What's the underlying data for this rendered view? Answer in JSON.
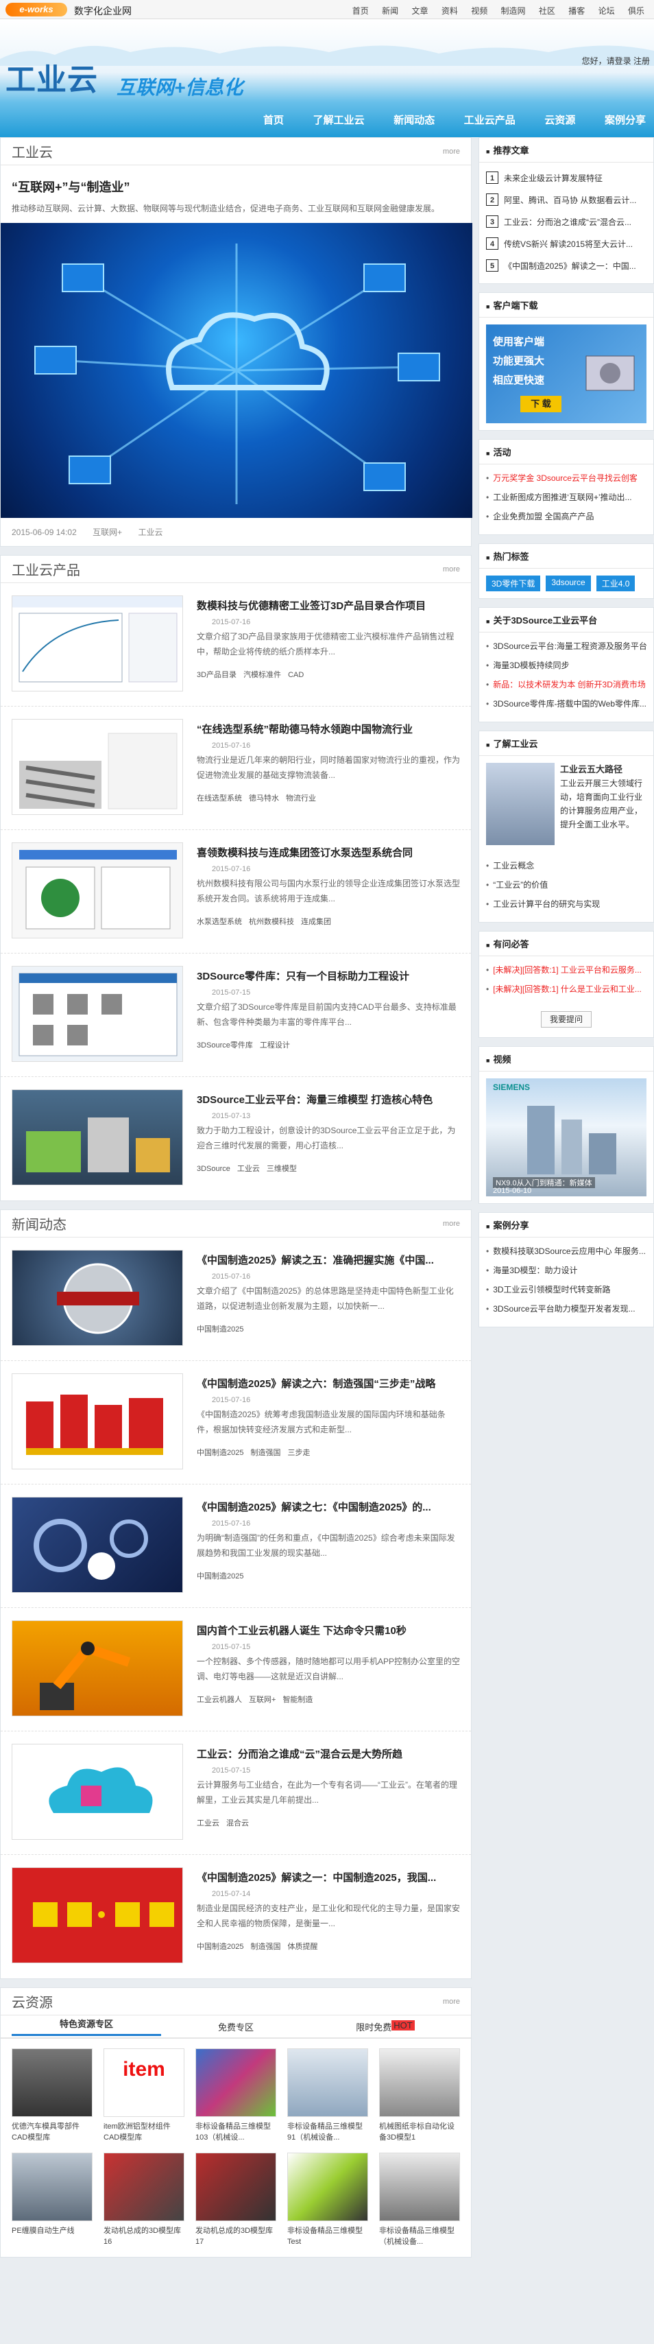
{
  "top": {
    "logo": "e-works",
    "site": "数字化企业网",
    "nav": [
      "首页",
      "新闻",
      "文章",
      "资料",
      "视频",
      "制造网",
      "社区",
      "播客",
      "论坛",
      "俱乐"
    ]
  },
  "banner": {
    "title": "工业云",
    "subtitle": "互联网+信息化",
    "login": "您好，请登录  注册",
    "menu": [
      "首页",
      "了解工业云",
      "新闻动态",
      "工业云产品",
      "云资源",
      "案例分享"
    ]
  },
  "cloud": {
    "header": "工业云",
    "more": "more",
    "title": "“互联网+”与“制造业”",
    "desc": "推动移动互联网、云计算、大数据、物联网等与现代制造业结合，促进电子商务、工业互联网和互联网金融健康发展。",
    "date": "2015-06-09 14:02",
    "tags": [
      "互联网+",
      "工业云"
    ]
  },
  "products": {
    "header": "工业云产品",
    "more": "more",
    "items": [
      {
        "title": "数模科技与优德精密工业签订3D产品目录合作项目",
        "date": "2015-07-16",
        "desc": "文章介绍了3D产品目录家族用于优德精密工业汽模标准件产品销售过程中，帮助企业将传统的纸介质样本升...",
        "tags": [
          "3D产品目录",
          "汽模标准件",
          "CAD"
        ]
      },
      {
        "title": "“在线选型系统”帮助德马特水领跑中国物流行业",
        "date": "2015-07-16",
        "desc": "物流行业是近几年来的朝阳行业，同时随着国家对物流行业的重视，作为促进物流业发展的基础支撑物流装备...",
        "tags": [
          "在线选型系统",
          "德马特水",
          "物流行业"
        ]
      },
      {
        "title": "喜领数模科技与连成集团签订水泵选型系统合同",
        "date": "2015-07-16",
        "desc": "杭州数模科技有限公司与国内水泵行业的领导企业连成集团签订水泵选型系统开发合同。该系统将用于连成集...",
        "tags": [
          "水泵选型系统",
          "杭州数模科技",
          "连成集团"
        ]
      },
      {
        "title": "3DSource零件库：只有一个目标助力工程设计",
        "date": "2015-07-15",
        "desc": "文章介绍了3DSource零件库是目前国内支持CAD平台最多、支持标准最新、包含零件种类最为丰富的零件库平台...",
        "tags": [
          "3DSource零件库",
          "工程设计"
        ]
      },
      {
        "title": "3DSource工业云平台：海量三维模型 打造核心特色",
        "date": "2015-07-13",
        "desc": "致力于助力工程设计，创意设计的3DSource工业云平台正立足于此，为迎合三维时代发展的需要，用心打造核...",
        "tags": [
          "3DSource",
          "工业云",
          "三维模型"
        ]
      }
    ]
  },
  "news": {
    "header": "新闻动态",
    "more": "more",
    "items": [
      {
        "title": "《中国制造2025》解读之五：准确把握实施《中国...",
        "date": "2015-07-16",
        "desc": "文章介绍了《中国制造2025》的总体思路是坚持走中国特色新型工业化道路，以促进制造业创新发展为主题，以加快新一...",
        "tags": [
          "中国制造2025"
        ]
      },
      {
        "title": "《中国制造2025》解读之六：制造强国“三步走”战略",
        "date": "2015-07-16",
        "desc": "《中国制造2025》统筹考虑我国制造业发展的国际国内环境和基础条件，根据加快转变经济发展方式和走新型...",
        "tags": [
          "中国制造2025",
          "制造强国",
          "三步走"
        ]
      },
      {
        "title": "《中国制造2025》解读之七：《中国制造2025》的...",
        "date": "2015-07-16",
        "desc": "为明确“制造强国”的任务和重点，《中国制造2025》综合考虑未来国际发展趋势和我国工业发展的现实基础...",
        "tags": [
          "中国制造2025"
        ]
      },
      {
        "title": "国内首个工业云机器人诞生 下达命令只需10秒",
        "date": "2015-07-15",
        "desc": "一个控制器、多个传感器，随时随地都可以用手机APP控制办公室里的空调、电灯等电器——这就是近汉自讲解...",
        "tags": [
          "工业云机器人",
          "互联网+",
          "智能制造"
        ]
      },
      {
        "title": "工业云：分而治之谁成“云”混合云是大势所趋",
        "date": "2015-07-15",
        "desc": "云计算服务与工业结合，在此为一个专有名词——“工业云”。在笔者的理解里，工业云其实是几年前提出...",
        "tags": [
          "工业云",
          "混合云"
        ]
      },
      {
        "title": "《中国制造2025》解读之一：中国制造2025，我国...",
        "date": "2015-07-14",
        "desc": "制造业是国民经济的支柱产业，是工业化和现代化的主导力量，是国家安全和人民幸福的物质保障，是衡量一...",
        "tags": [
          "中国制造2025",
          "制造强国",
          "体质提醒"
        ]
      }
    ]
  },
  "resources": {
    "header": "云资源",
    "more": "more",
    "tabs": [
      "特色资源专区",
      "免费专区",
      "限时免费"
    ],
    "hot": "HOT",
    "items": [
      "优德汽车模具零部件CAD模型库",
      "item欧洲铝型材组件CAD模型库",
      "非标设备精品三维模型103（机械设...",
      "非标设备精品三维模型91（机械设备...",
      "机械图纸非标自动化设备3D模型1",
      "PE缠膜自动生产线",
      "发动机总成的3D模型库16",
      "发动机总成的3D模型库17",
      "非标设备精品三维模型Test",
      "非标设备精品三维模型（机械设备..."
    ]
  },
  "side": {
    "recommend": {
      "header": "推荐文章",
      "items": [
        "未来企业级云计算发展特征",
        "阿里、腾讯、百马协 从数据看云计...",
        "工业云：分而治之谁成“云”混合云...",
        "传统VS新兴 解读2015将至大云计...",
        "《中国制造2025》解读之一：中国..."
      ]
    },
    "download": {
      "header": "客户端下载",
      "line1": "使用客户端",
      "line2": "功能更强大",
      "line3": "相应更快速",
      "btn": "下 载"
    },
    "activity": {
      "header": "活动",
      "items": [
        "万元奖学金 3Dsource云平台寻找云创客",
        "工业新图成方图推进‘互联网+’推动出...",
        "企业免费加盟 全国高产产品"
      ]
    },
    "hottags": {
      "header": "热门标签",
      "tags": [
        "3D零件下载",
        "3dsource",
        "工业4.0"
      ]
    },
    "platform": {
      "header": "关于3DSource工业云平台",
      "items": [
        "3DSource云平台:海量工程资源及服务平台...",
        "海量3D模板持续同步",
        "新品：以技术研发为本 创新开3D消费市场...",
        "3DSource零件库-搭载中国的Web零件库..."
      ]
    },
    "about": {
      "header": "了解工业云",
      "name": "工业云五大路径",
      "text": "工业云开展三大领域行动，培育面向工业行业的计算服务应用产业，提升全面工业水平。",
      "items": [
        "工业云概念",
        "“工业云”的价值",
        "工业云计算平台的研究与实现"
      ]
    },
    "qa": {
      "header": "有问必答",
      "items": [
        "[未解决][回答数:1] 工业云平台和云服务...",
        "[未解决][回答数:1] 什么是工业云和工业..."
      ],
      "btn": "我要提问"
    },
    "video": {
      "header": "视频",
      "brand": "SIEMENS",
      "caption": "NX9.0从入门到精通：新媒体",
      "date": "2015-06-10"
    },
    "cases": {
      "header": "案例分享",
      "items": [
        "数模科技联3DSource云应用中心 年服务...",
        "海量3D模型：助力设计",
        "3D工业云引领模型时代转变新路",
        "3DSource云平台助力模型开发者发现..."
      ]
    }
  },
  "colors": {
    "brand": "#1e6bb0",
    "accent": "#1f8fdf",
    "bg": "#e9edf1"
  }
}
